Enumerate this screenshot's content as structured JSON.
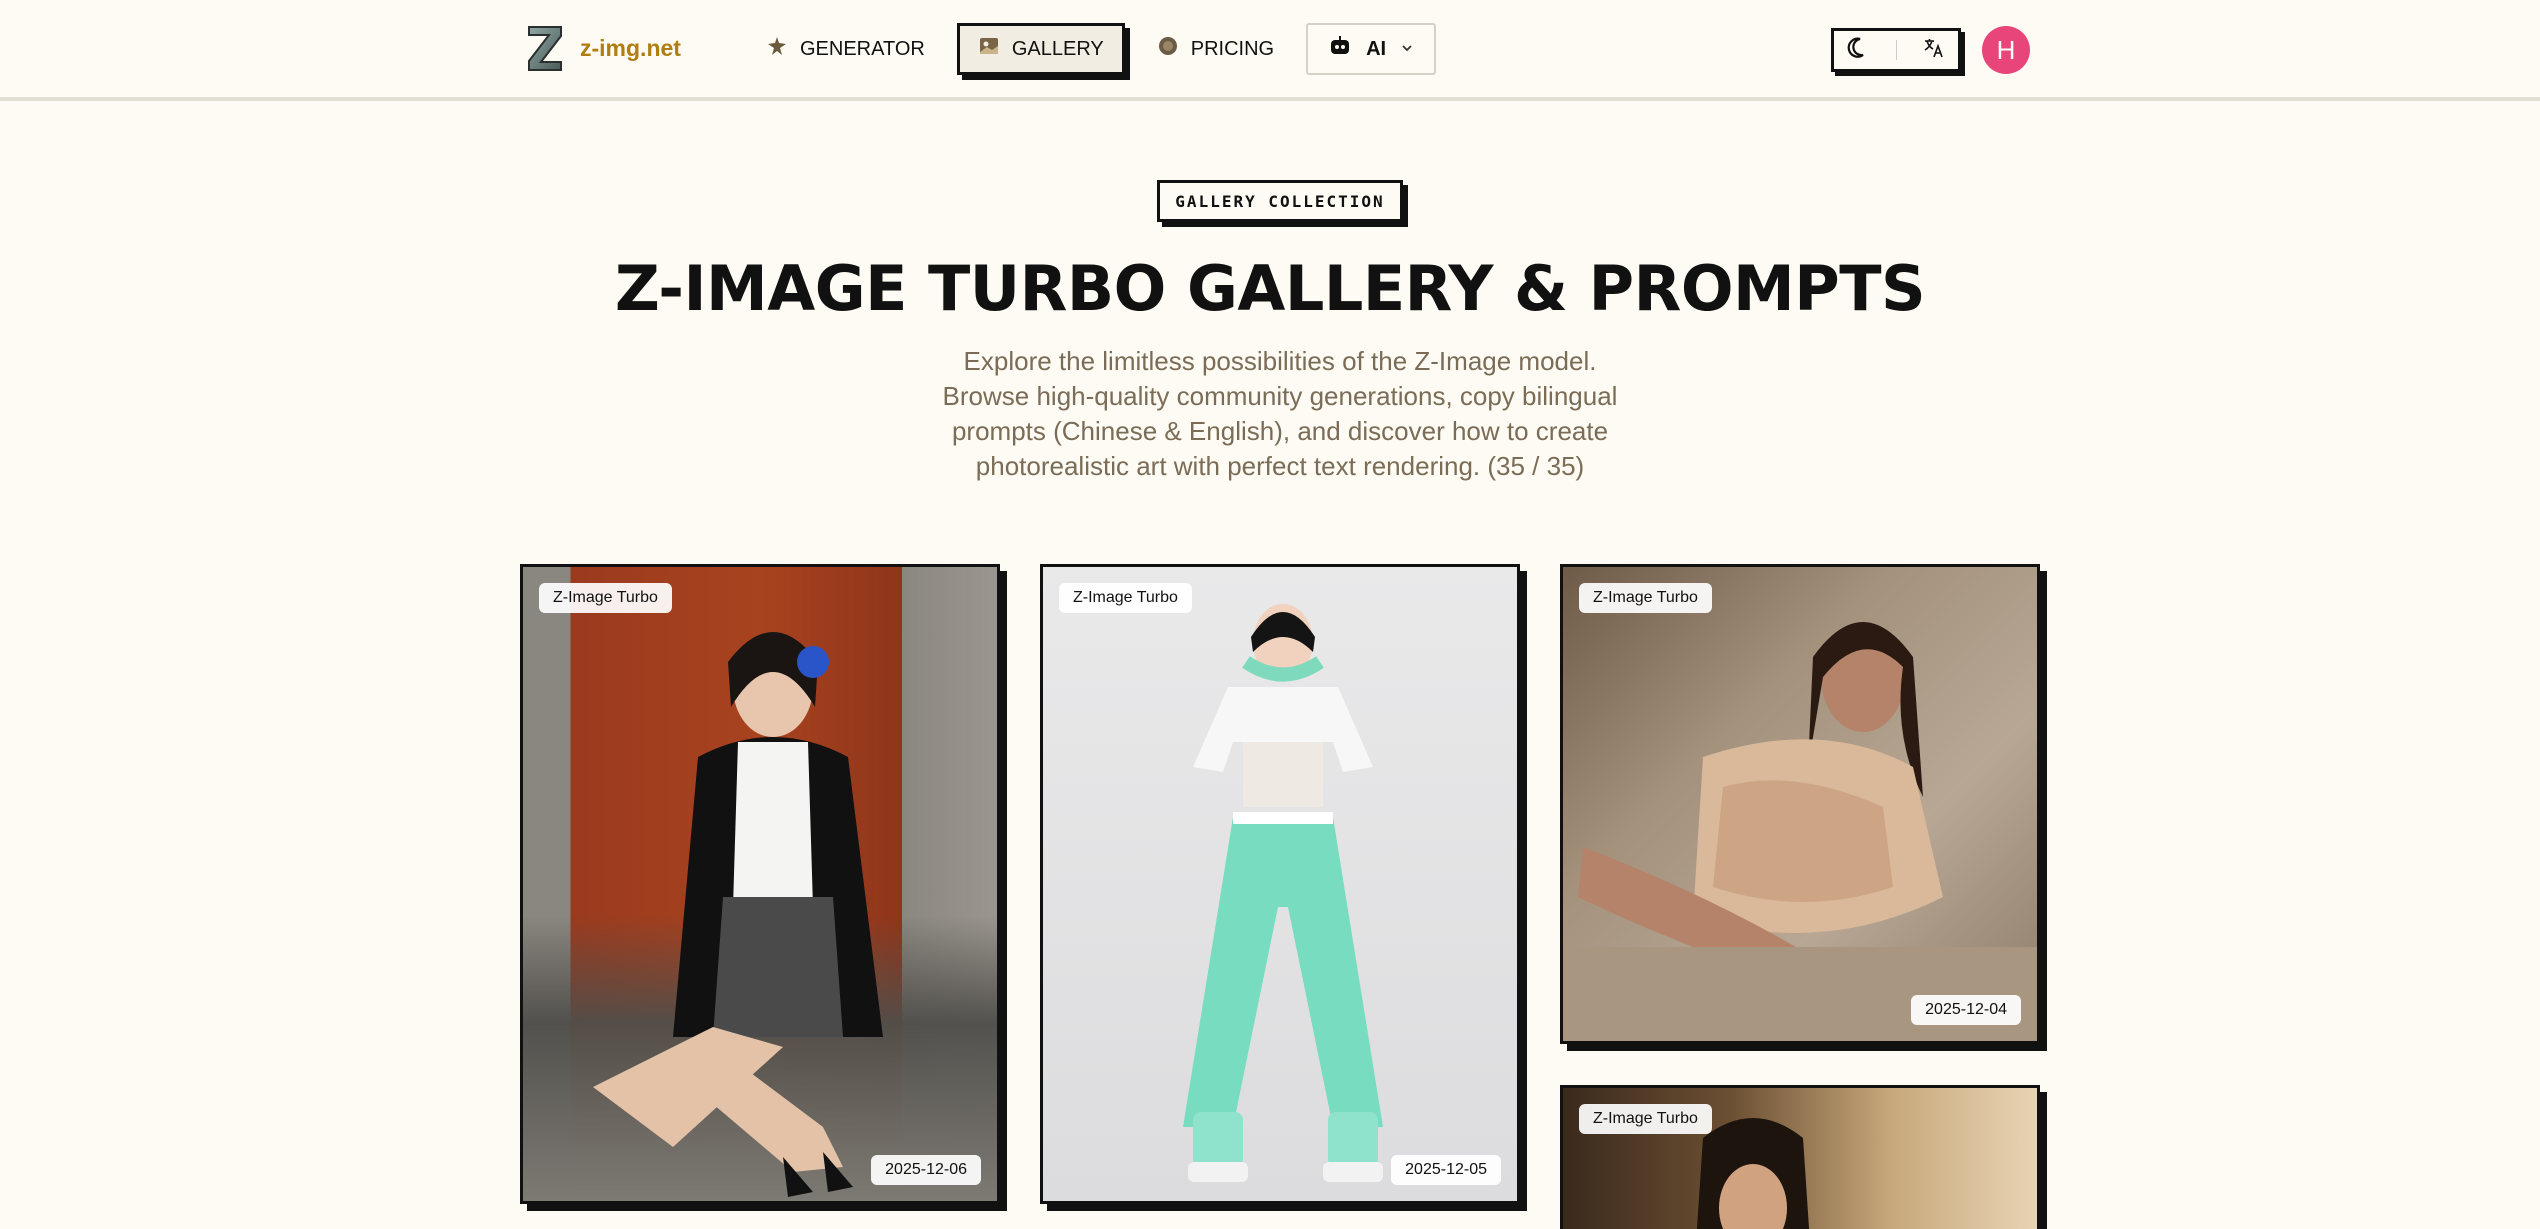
{
  "header": {
    "logo_text": "z-img.net",
    "nav": [
      {
        "label": "GENERATOR",
        "icon": "puzzle-icon"
      },
      {
        "label": "GALLERY",
        "icon": "image-gallery-icon",
        "active": true
      },
      {
        "label": "PRICING",
        "icon": "coin-icon"
      },
      {
        "label": "AI",
        "icon": "robot-icon",
        "dropdown": true
      }
    ],
    "avatar_initial": "H"
  },
  "hero": {
    "badge": "GALLERY COLLECTION",
    "title": "Z-IMAGE TURBO GALLERY & PROMPTS",
    "subtitle": "Explore the limitless possibilities of the Z-Image model. Browse high-quality community generations, copy bilingual prompts (Chinese & English), and discover how to create photorealistic art with perfect text rendering. (35 / 35)"
  },
  "gallery": {
    "cards": [
      {
        "model": "Z-Image Turbo",
        "date": "2025-12-06"
      },
      {
        "model": "Z-Image Turbo",
        "date": "2025-12-05"
      },
      {
        "model": "Z-Image Turbo",
        "date": "2025-12-04"
      },
      {
        "model": "Z-Image Turbo",
        "date": ""
      }
    ]
  },
  "colors": {
    "background": "#fdfbf3",
    "brand": "#b07d12",
    "avatar": "#e8457a",
    "subtitle": "#7a6c56"
  }
}
